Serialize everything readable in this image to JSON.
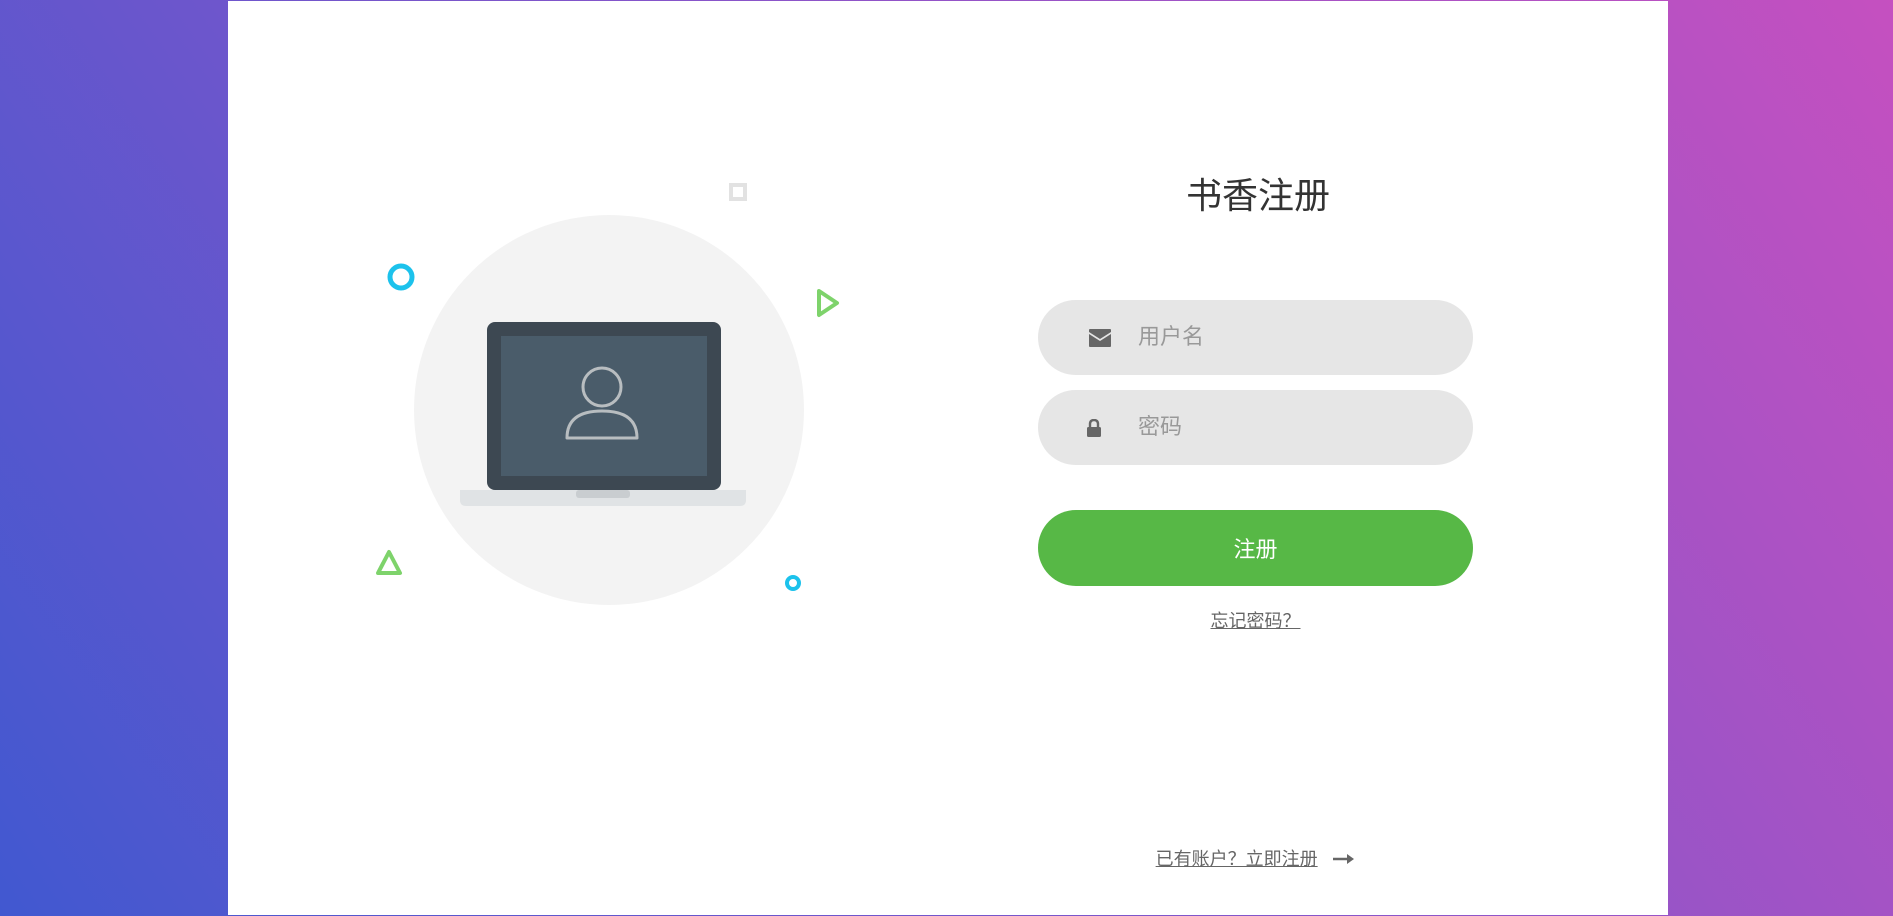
{
  "form": {
    "title": "书香注册",
    "username_placeholder": "用户名",
    "password_placeholder": "密码",
    "submit_label": "注册",
    "forgot_label": "忘记密码？",
    "login_prompt_label": "已有账户？立即注册"
  },
  "icons": {
    "username_icon": "envelope-icon",
    "password_icon": "lock-icon",
    "login_arrow_icon": "long-arrow-right-icon",
    "illustration": "laptop-user-icon"
  },
  "colors": {
    "primary_button": "#57b846",
    "field_background": "#e6e6e6",
    "accent_blue": "#1cc2ec",
    "accent_green": "#7ed36b",
    "background_gradient_start": "#4158d0",
    "background_gradient_end": "#c850c0"
  }
}
